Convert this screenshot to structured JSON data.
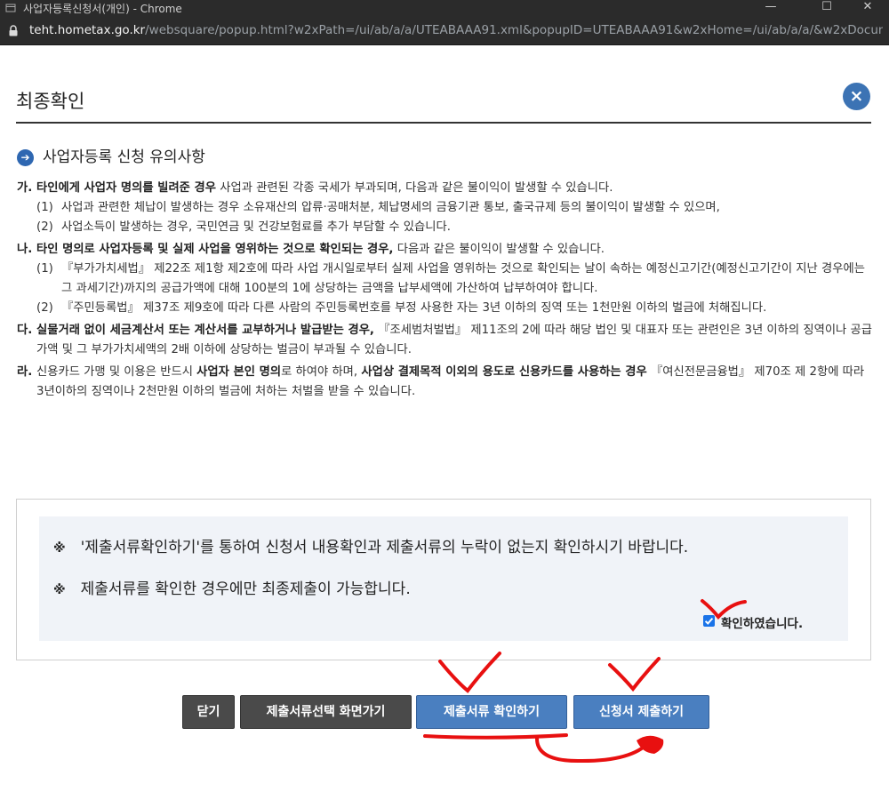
{
  "window": {
    "title": "사업자등록신청서(개인) - Chrome",
    "minimize": "—",
    "restore": "☐",
    "close": "✕"
  },
  "address_bar": {
    "host": "teht.hometax.go.kr",
    "path": "/websquare/popup.html?w2xPath=/ui/ab/a/a/UTEABAAA91.xml&popupID=UTEABAAA91&w2xHome=/ui/ab/a/a/&w2xDocument…"
  },
  "dialog": {
    "title": "최종확인",
    "close_glyph": "×"
  },
  "section": {
    "heading": "사업자등록 신청 유의사항",
    "arrow_glyph": "➔"
  },
  "notice": {
    "ga": {
      "marker": "가.",
      "bold": "타인에게 사업자 명의를 빌려준 경우",
      "text": " 사업과 관련된 각종 국세가 부과되며, 다음과 같은 불이익이 발생할 수 있습니다.",
      "subs": [
        {
          "marker": "(1)",
          "text": "사업과 관련한 체납이 발생하는 경우 소유재산의 압류·공매처분, 체납명세의 금융기관 통보, 출국규제 등의 불이익이 발생할 수 있으며,"
        },
        {
          "marker": "(2)",
          "text": "사업소득이 발생하는 경우, 국민연금 및 건강보험료를 추가 부담할 수 있습니다."
        }
      ]
    },
    "na": {
      "marker": "나.",
      "bold": "타인 명의로 사업자등록 및 실제 사업을 영위하는 것으로 확인되는 경우,",
      "text": " 다음과 같은 불이익이 발생할 수 있습니다.",
      "subs": [
        {
          "marker": "(1)",
          "text": "『부가가치세법』 제22조 제1항 제2호에 따라 사업 개시일로부터 실제 사업을 영위하는 것으로 확인되는 날이 속하는 예정신고기간(예정신고기간이 지난 경우에는 그 과세기간)까지의 공급가액에 대해 100분의 1에 상당하는 금액을 납부세액에 가산하여 납부하여야 합니다."
        },
        {
          "marker": "(2)",
          "text": "『주민등록법』 제37조 제9호에 따라 다른 사람의 주민등록번호를 부정 사용한 자는 3년 이하의 징역 또는 1천만원 이하의 벌금에 처해집니다."
        }
      ]
    },
    "da": {
      "marker": "다.",
      "bold": "실물거래 없이 세금계산서 또는 계산서를 교부하거나 발급받는 경우,",
      "text": " 『조세범처벌법』 제11조의 2에 따라 해당 법인 및 대표자 또는 관련인은 3년 이하의 징역이나 공급가액 및 그 부가가치세액의 2배 이하에 상당하는 벌금이 부과될 수 있습니다."
    },
    "ra": {
      "marker": "라.",
      "text1": "신용카드 가맹 및 이용은 반드시 ",
      "bold1": "사업자 본인 명의",
      "text2": "로 하여야 하며, ",
      "bold2": "사업상 결제목적 이외의 용도로 신용카드를 사용하는 경우",
      "text3": " 『여신전문금융법』 제70조 제 2항에 따라 3년이하의 징역이나 2천만원 이하의 벌금에 처하는 처벌을 받을 수 있습니다."
    }
  },
  "confirm": {
    "ref_mark": "※",
    "line1": "'제출서류확인하기'를 통하여 신청서 내용확인과 제출서류의 누락이 없는지 확인하시기 바랍니다.",
    "line2": "제출서류를 확인한 경우에만 최종제출이 가능합니다.",
    "checkbox_label": "확인하였습니다.",
    "checked": true
  },
  "buttons": {
    "close": "닫기",
    "doc_select": "제출서류선택 화면가기",
    "doc_check": "제출서류 확인하기",
    "submit": "신청서 제출하기"
  },
  "colors": {
    "accent_blue": "#4a7fc0",
    "dark_button": "#4a4a4a",
    "annotation_red": "#e81010"
  }
}
